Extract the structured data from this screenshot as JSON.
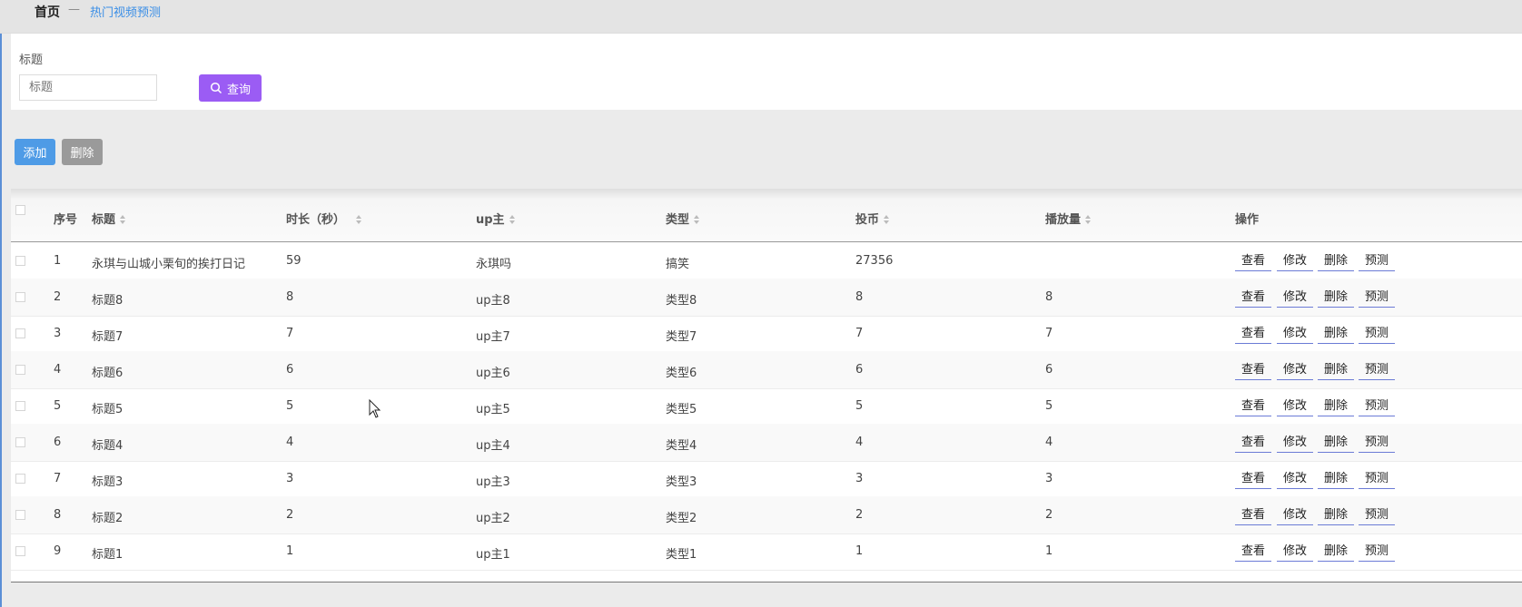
{
  "breadcrumb": {
    "home": "首页",
    "separator": "—",
    "current": "热门视频预测"
  },
  "search": {
    "label": "标题",
    "placeholder": "标题",
    "button_label": "查询",
    "button_icon": "search-icon"
  },
  "toolbar": {
    "add_label": "添加",
    "delete_label": "删除"
  },
  "table": {
    "columns": [
      "序号",
      "标题",
      "时长（秒）",
      "up主",
      "类型",
      "投币",
      "播放量",
      "操作"
    ],
    "actions": [
      "查看",
      "修改",
      "删除",
      "预测"
    ],
    "rows": [
      [
        "1",
        "永琪与山城小栗旬的挨打日记",
        "59",
        "永琪吗",
        "搞笑",
        "27356",
        ""
      ],
      [
        "2",
        "标题8",
        "8",
        "up主8",
        "类型8",
        "8",
        "8"
      ],
      [
        "3",
        "标题7",
        "7",
        "up主7",
        "类型7",
        "7",
        "7"
      ],
      [
        "4",
        "标题6",
        "6",
        "up主6",
        "类型6",
        "6",
        "6"
      ],
      [
        "5",
        "标题5",
        "5",
        "up主5",
        "类型5",
        "5",
        "5"
      ],
      [
        "6",
        "标题4",
        "4",
        "up主4",
        "类型4",
        "4",
        "4"
      ],
      [
        "7",
        "标题3",
        "3",
        "up主3",
        "类型3",
        "3",
        "3"
      ],
      [
        "8",
        "标题2",
        "2",
        "up主2",
        "类型2",
        "2",
        "2"
      ],
      [
        "9",
        "标题1",
        "1",
        "up主1",
        "类型1",
        "1",
        "1"
      ]
    ]
  },
  "colors": {
    "accent": "#9b5cf4",
    "add_button": "#4e9be6",
    "delete_button": "#9a9a9a",
    "link": "#3a8ee6"
  }
}
